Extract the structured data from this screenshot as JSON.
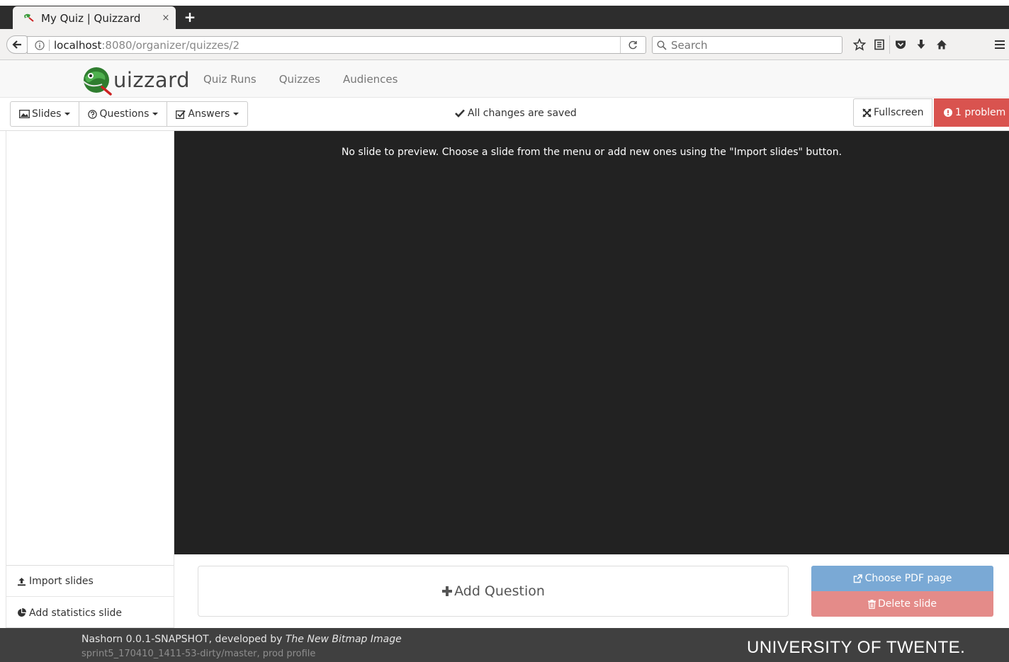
{
  "browser": {
    "tab_title": "My Quiz | Quizzard",
    "tab_close": "×",
    "new_tab": "+",
    "url_host": "localhost",
    "url_path": ":8080/organizer/quizzes/2",
    "search_placeholder": "Search",
    "icons": [
      "star-icon",
      "reading-list-icon",
      "pocket-icon",
      "download-icon",
      "home-icon",
      "menu-icon"
    ]
  },
  "app": {
    "brand_text": "uizzard",
    "nav": [
      "Quiz Runs",
      "Quizzes",
      "Audiences"
    ]
  },
  "toolbar": {
    "slides": "Slides",
    "questions": "Questions",
    "answers": "Answers",
    "saved_status": "All changes are saved",
    "fullscreen": "Fullscreen",
    "problem": "1 problem"
  },
  "sidebar": {
    "import_slides": "Import slides",
    "add_statistics_slide": "Add statistics slide"
  },
  "preview": {
    "message": "No slide to preview. Choose a slide from the menu or add new ones using the \"Import slides\" button."
  },
  "actions": {
    "add_question": "Add Question",
    "choose_pdf_page": "Choose PDF page",
    "delete_slide": "Delete slide"
  },
  "footer": {
    "line1_prefix": "Nashorn 0.0.1-SNAPSHOT, developed by ",
    "line1_company": "The New Bitmap Image",
    "line2": "sprint5_170410_1411-53-dirty/master, prod profile",
    "university": "UNIVERSITY OF TWENTE."
  },
  "colors": {
    "danger": "#d9534f",
    "info_disabled": "#7aa9d5",
    "danger_disabled": "#e48b89",
    "preview_bg": "#222222",
    "footer_bg": "#404040"
  }
}
